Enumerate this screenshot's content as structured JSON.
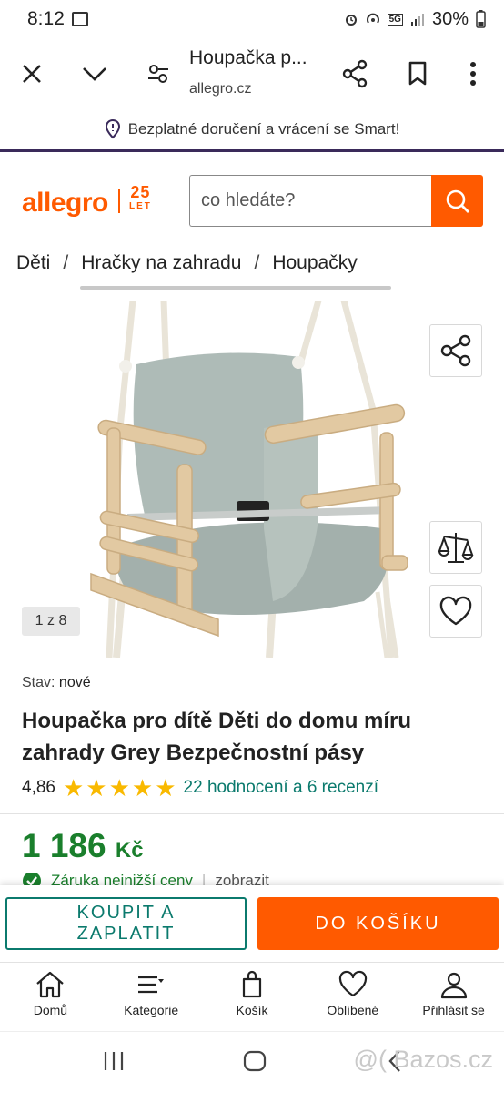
{
  "status_bar": {
    "time": "8:12",
    "battery": "30%",
    "network": "5G"
  },
  "browser": {
    "page_title": "Houpačka p...",
    "url": "allegro.cz"
  },
  "smart_banner": {
    "text": "Bezplatné doručení a vrácení se Smart!"
  },
  "header": {
    "logo": "allegro",
    "anniversary_number": "25",
    "anniversary_word": "LET",
    "search_placeholder": "co hledáte?"
  },
  "breadcrumb": [
    "Děti",
    "Hračky na zahradu",
    "Houpačky"
  ],
  "gallery": {
    "counter": "1 z 8"
  },
  "product": {
    "condition_label": "Stav:",
    "condition_value": "nové",
    "title": "Houpačka pro dítě Děti do domu míru zahrady Grey Bezpečnostní pásy",
    "rating": "4,86",
    "stars": 5,
    "reviews": "22 hodnocení a 6 recenzí",
    "price": "1 186",
    "currency": "Kč",
    "guarantee": "Záruka nejnižší ceny",
    "guarantee_link": "zobrazit"
  },
  "actions": {
    "buy_now": "KOUPIT A ZAPLATIT",
    "add_to_cart": "DO KOŠÍKU"
  },
  "bottom_nav": [
    {
      "label": "Domů",
      "icon": "home-icon"
    },
    {
      "label": "Kategorie",
      "icon": "menu-icon"
    },
    {
      "label": "Košík",
      "icon": "cart-icon"
    },
    {
      "label": "Oblíbené",
      "icon": "heart-icon"
    },
    {
      "label": "Přihlásit se",
      "icon": "user-icon"
    }
  ],
  "watermark": "@( Bazos.cz",
  "colors": {
    "brand": "#ff5a00",
    "price": "#1a7f2c",
    "link": "#0b7a6d",
    "stars": "#f9b900"
  }
}
